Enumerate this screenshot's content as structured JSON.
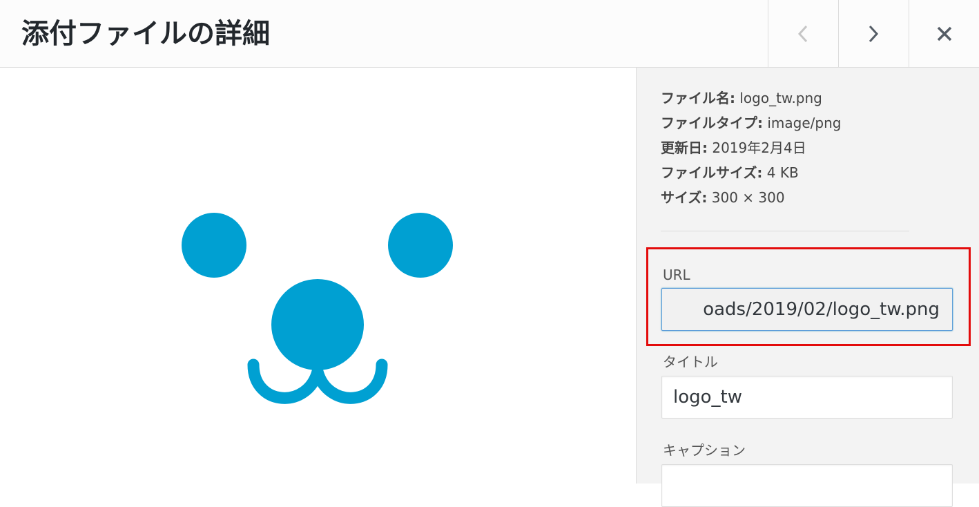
{
  "header": {
    "title": "添付ファイルの詳細",
    "prev_icon": "chevron-left-icon",
    "next_icon": "chevron-right-icon",
    "close_icon": "close-icon"
  },
  "preview": {
    "image_icon": "bear-face-logo",
    "color": "#00a0d2"
  },
  "file_info": [
    {
      "key": "ファイル名:",
      "value": " logo_tw.png"
    },
    {
      "key": "ファイルタイプ:",
      "value": " image/png"
    },
    {
      "key": "更新日:",
      "value": " 2019年2月4日"
    },
    {
      "key": "ファイルサイズ:",
      "value": " 4 KB"
    },
    {
      "key": "サイズ:",
      "value": " 300 × 300"
    }
  ],
  "fields": {
    "url": {
      "label": "URL",
      "value": "oads/2019/02/logo_tw.png"
    },
    "title": {
      "label": "タイトル",
      "value": "logo_tw"
    },
    "caption": {
      "label": "キャプション",
      "value": ""
    }
  },
  "colors": {
    "highlight": "#e30b0b",
    "focus_border": "#5b9dd9",
    "sidebar_bg": "#f3f3f3"
  }
}
